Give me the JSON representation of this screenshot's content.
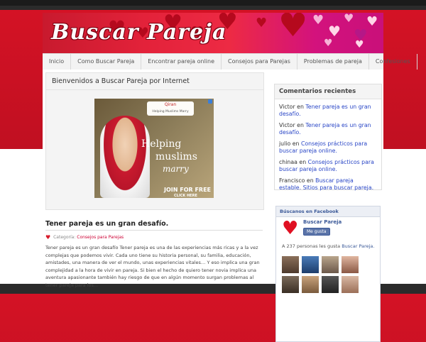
{
  "header": {
    "logo_text": "Buscar Pareja"
  },
  "nav": {
    "items": [
      {
        "label": "Inicio"
      },
      {
        "label": "Como Buscar Pareja"
      },
      {
        "label": "Encontrar pareja online"
      },
      {
        "label": "Consejos para Parejas"
      },
      {
        "label": "Problemas de pareja"
      },
      {
        "label": "Confesiones"
      }
    ]
  },
  "main": {
    "welcome_title": "Bienvenidos a Buscar Pareja por Internet",
    "ad": {
      "brand": "Qiran",
      "brand_sub": "Helping Muslims Marry",
      "line1": "Helping",
      "line2": "muslims",
      "line3": "marry",
      "cta": "JOIN FOR FREE",
      "cta_sub": "CLICK HERE"
    },
    "post": {
      "title": "Tener pareja es un gran desafío.",
      "category_label": "Categoría:",
      "category_link": "Consejos para Parejas",
      "body": "Tener pareja es un gran desafío Tener pareja es una de las experiencias más ricas y a la vez complejas que podemos vivir. Cada uno tiene su historia personal, su familia, educación, amistades, una manera de ver el mundo, unas experiencias vitales… Y eso implica una gran complejidad a la hora de vivir en pareja. Si bien el hecho de quiero tener novia implica una aventura apasionante también hay riesgo de que en algún momento surgan problemas al tener pareja para los..."
    }
  },
  "sidebar": {
    "recent_title": "Comentarios recientes",
    "comments": [
      {
        "author": "Victor",
        "connector": "en",
        "link": "Tener pareja es un gran desafío."
      },
      {
        "author": "Victor",
        "connector": "en",
        "link": "Tener pareja es un gran desafío."
      },
      {
        "author": "julio",
        "connector": "en",
        "link": "Consejos prácticos para buscar pareja online."
      },
      {
        "author": "chinaa",
        "connector": "en",
        "link": "Consejos prácticos para buscar pareja online."
      },
      {
        "author": "Francisco",
        "connector": "en",
        "link": "Buscar pareja estable. Sitios para buscar pareja."
      }
    ],
    "facebook": {
      "title": "Búscanos en Facebook",
      "page_name": "Buscar Pareja",
      "like_label": "Me gusta",
      "count_text": "A 237 personas les gusta",
      "count_link": "Buscar Pareja."
    }
  },
  "colors": {
    "brand_red": "#d41225",
    "link_blue": "#2845c6",
    "facebook_blue": "#3b5998"
  }
}
